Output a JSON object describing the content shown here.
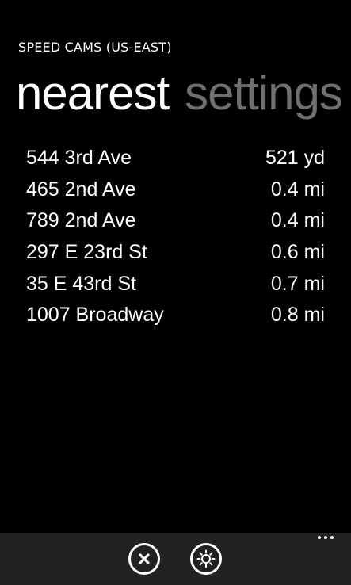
{
  "app": {
    "title": "SPEED CAMS (US-EAST)"
  },
  "pivot": {
    "items": [
      {
        "label": "nearest",
        "active": true
      },
      {
        "label": "settings",
        "active": false
      }
    ]
  },
  "cameras": [
    {
      "address": "544 3rd Ave",
      "distance": "521 yd"
    },
    {
      "address": "465 2nd Ave",
      "distance": "0.4 mi"
    },
    {
      "address": "789 2nd Ave",
      "distance": "0.4 mi"
    },
    {
      "address": "297 E 23rd St",
      "distance": "0.6 mi"
    },
    {
      "address": "35 E 43rd St",
      "distance": "0.7 mi"
    },
    {
      "address": "1007 Broadway",
      "distance": "0.8 mi"
    }
  ],
  "app_bar": {
    "buttons": [
      {
        "icon": "close-icon"
      },
      {
        "icon": "brightness-icon"
      }
    ],
    "more_icon": "ellipsis-icon"
  },
  "colors": {
    "background": "#000000",
    "foreground": "#ffffff",
    "inactive_pivot": "#6f6f6f",
    "app_bar": "#212121"
  }
}
